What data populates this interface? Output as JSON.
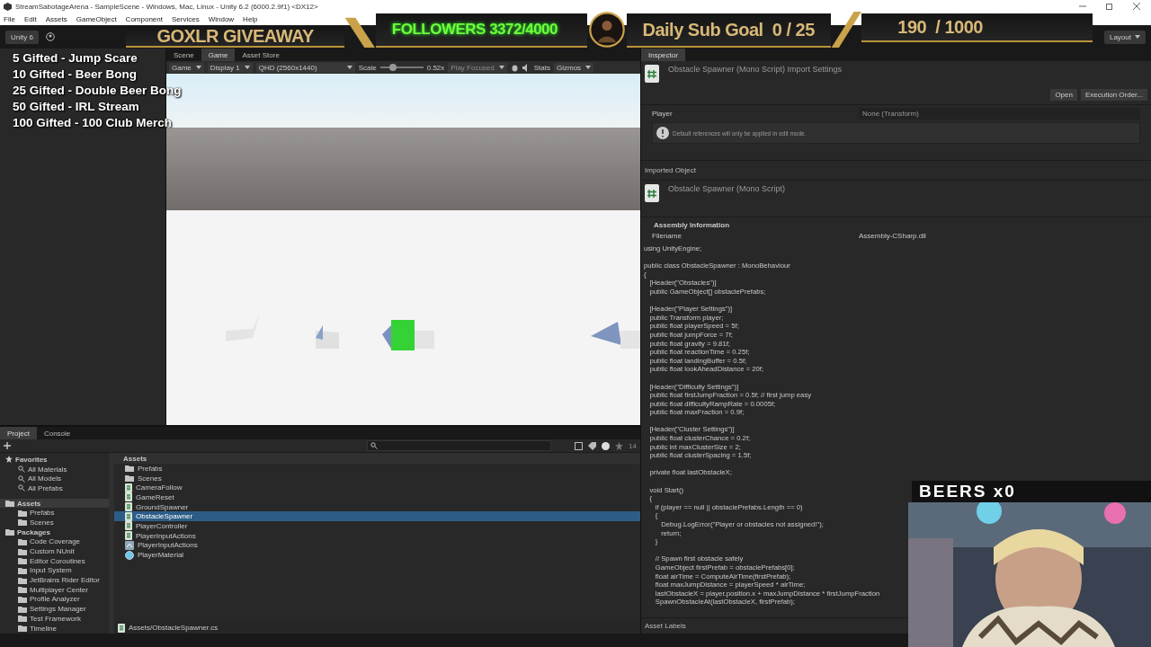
{
  "window": {
    "title": "StreamSabotageArena - SampleScene - Windows, Mac, Linux - Unity 6.2 (6000.2.9f1) <DX12>"
  },
  "menu": [
    "File",
    "Edit",
    "Assets",
    "GameObject",
    "Component",
    "Services",
    "Window",
    "Help"
  ],
  "toolbar": {
    "account": "Unity 6",
    "layout": "Layout"
  },
  "stream_overlay": {
    "giveaway": "GOXLR GIVEAWAY",
    "followers": "FOLLOWERS 3372/4000",
    "sub_goal": "Daily Sub Goal  0 / 25",
    "counter": "190  / 1000",
    "beers": "BEERS x0",
    "rewards": [
      "5 Gifted - Jump Scare",
      "10 Gifted - Beer Bong",
      "25 Gifted - Double Beer Bong",
      "50 Gifted - IRL Stream",
      "100 Gifted - 100 Club Merch"
    ]
  },
  "game_panel": {
    "tabs": [
      {
        "label": "Scene",
        "selected": false
      },
      {
        "label": "Game",
        "selected": true
      },
      {
        "label": "Asset Store",
        "selected": false
      }
    ],
    "view": "Game",
    "display": "Display 1",
    "resolution": "QHD (2560x1440)",
    "scale_label": "Scale",
    "scale": {
      "level": 0.3
    },
    "scale_value": "0.52x",
    "play_mode": "Play Focused",
    "stats": "Stats",
    "gizmos": "Gizmos"
  },
  "inspector": {
    "tab": "Inspector",
    "header": "Obstacle Spawner (Mono Script) Import Settings",
    "buttons": [
      "Open",
      "Execution Order..."
    ],
    "field": {
      "label": "Player",
      "value": "None (Transform)"
    },
    "warning": "Default references will only be applied in edit mode.",
    "imported_heading": "Imported Object",
    "imported_title": "Obstacle Spawner (Mono Script)",
    "assembly_heading": "Assembly Information",
    "filename_label": "Filename",
    "filename": "Assembly-CSharp.dll",
    "code": "using UnityEngine;\n\npublic class ObstacleSpawner : MonoBehaviour\n{\n   [Header(\"Obstacles\")]\n   public GameObject[] obstaclePrefabs;\n\n   [Header(\"Player Settings\")]\n   public Transform player;\n   public float playerSpeed = 5f;\n   public float jumpForce = 7f;\n   public float gravity = 9.81f;\n   public float reactionTime = 0.25f;\n   public float landingBuffer = 0.5f;\n   public float lookAheadDistance = 20f;\n\n   [Header(\"Difficulty Settings\")]\n   public float firstJumpFraction = 0.5f; // first jump easy\n   public float difficultyRampRate = 0.0005f;\n   public float maxFraction = 0.9f;\n\n   [Header(\"Cluster Settings\")]\n   public float clusterChance = 0.2f;\n   public int maxClusterSize = 2;\n   public float clusterSpacing = 1.5f;\n\n   private float lastObstacleX;\n\n   void Start()\n   {\n      if (player == null || obstaclePrefabs.Length == 0)\n      {\n         Debug.LogError(\"Player or obstacles not assigned!\");\n         return;\n      }\n\n      // Spawn first obstacle safely\n      GameObject firstPrefab = obstaclePrefabs[0];\n      float airTime = ComputeAirTime(firstPrefab);\n      float maxJumpDistance = playerSpeed * airTime;\n      lastObstacleX = player.position.x + maxJumpDistance * firstJumpFraction\n      SpawnObstacleAt(lastObstacleX, firstPrefab);",
    "footer": "Asset Labels"
  },
  "project": {
    "tabs": [
      {
        "label": "Project",
        "selected": true
      },
      {
        "label": "Console",
        "selected": false
      }
    ],
    "count": "14",
    "favorites": {
      "label": "Favorites",
      "items": [
        "All Materials",
        "All Models",
        "All Prefabs"
      ]
    },
    "tree": [
      {
        "label": "Assets",
        "selected": true,
        "children": [
          {
            "label": "Prefabs",
            "selected": false
          },
          {
            "label": "Scenes",
            "selected": false
          }
        ]
      },
      {
        "label": "Packages",
        "selected": false,
        "children": [
          {
            "label": "Code Coverage",
            "selected": false
          },
          {
            "label": "Custom NUnit",
            "selected": false
          },
          {
            "label": "Editor Coroutines",
            "selected": false
          },
          {
            "label": "Input System",
            "selected": false
          },
          {
            "label": "JetBrains Rider Editor",
            "selected": false
          },
          {
            "label": "Multiplayer Center",
            "selected": false
          },
          {
            "label": "Profile Analyzer",
            "selected": false
          },
          {
            "label": "Settings Manager",
            "selected": false
          },
          {
            "label": "Test Framework",
            "selected": false
          },
          {
            "label": "Timeline",
            "selected": false
          }
        ]
      }
    ],
    "breadcrumb": "Assets",
    "assets": [
      {
        "name": "Prefabs",
        "kind": "folder",
        "selected": false
      },
      {
        "name": "Scenes",
        "kind": "folder",
        "selected": false
      },
      {
        "name": "CameraFollow",
        "kind": "script",
        "selected": false
      },
      {
        "name": "GameReset",
        "kind": "script",
        "selected": false
      },
      {
        "name": "GroundSpawner",
        "kind": "script",
        "selected": false
      },
      {
        "name": "ObstacleSpawner",
        "kind": "script",
        "selected": true
      },
      {
        "name": "PlayerController",
        "kind": "script",
        "selected": false
      },
      {
        "name": "PlayerInputActions",
        "kind": "script",
        "selected": false
      },
      {
        "name": "PlayerInputActions",
        "kind": "input",
        "selected": false
      },
      {
        "name": "PlayerMaterial",
        "kind": "material",
        "selected": false
      }
    ],
    "path": "Assets/ObstacleSpawner.cs"
  }
}
